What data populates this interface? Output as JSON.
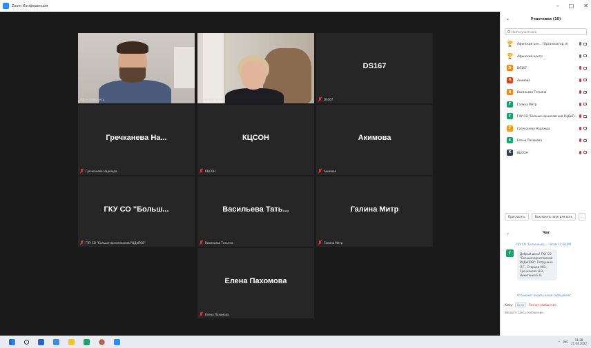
{
  "window": {
    "title": "Zoom Конференция",
    "controls": [
      "–",
      "□",
      "✕"
    ]
  },
  "tiles": [
    {
      "type": "video",
      "camera": "man",
      "caption": "Афинский центр",
      "muted": false,
      "active": true
    },
    {
      "type": "video",
      "camera": "woman",
      "caption": "Афинский центр",
      "muted": false,
      "active": false
    },
    {
      "type": "name",
      "display": "DS167",
      "caption": "DS167",
      "muted": true
    },
    {
      "type": "name",
      "display": "Гречканева  На...",
      "caption": "Гречканева Надежда",
      "muted": true
    },
    {
      "type": "name",
      "display": "КЦСОН",
      "caption": "КЦСОН",
      "muted": true
    },
    {
      "type": "name",
      "display": "Акимова",
      "caption": "Акимова",
      "muted": true
    },
    {
      "type": "name",
      "display": "ГКУ СО \"Больш...",
      "caption": "ГКУ СО \"Большечерниговский РЦДиПОВ\"",
      "muted": true
    },
    {
      "type": "name",
      "display": "Васильева  Тать...",
      "caption": "Васильева Татьяна",
      "muted": true
    },
    {
      "type": "name",
      "display": "Галина Митр",
      "caption": "Галина Митр",
      "muted": true
    },
    {
      "type": "name",
      "display": "Елена Пахомова",
      "caption": "Елена Пахомова",
      "muted": true
    }
  ],
  "participants_panel": {
    "title": "Участники (10)",
    "search_placeholder": "Найти участника",
    "participants": [
      {
        "name": "Афинский цен... (Организатор, я)",
        "avatar": "trophy",
        "color": "#f0b400",
        "muted": false
      },
      {
        "name": "Афинский центр",
        "avatar": "trophy",
        "color": "#f0b400",
        "muted": false
      },
      {
        "name": "DS167",
        "avatar": "D",
        "color": "#f08a1c",
        "muted": true
      },
      {
        "name": "Акимова",
        "avatar": "А",
        "color": "#d9481c",
        "muted": true
      },
      {
        "name": "Васильева Татьяна",
        "avatar": "В",
        "color": "#f08a1c",
        "muted": true
      },
      {
        "name": "Галина Митр",
        "avatar": "Г",
        "color": "#1aa36b",
        "muted": true
      },
      {
        "name": "ГКУ СО \"Большечерниговский РЦДиП...",
        "avatar": "Г",
        "color": "#1aa36b",
        "muted": true
      },
      {
        "name": "Гречканева Надежда",
        "avatar": "Г",
        "color": "#f0a020",
        "muted": true
      },
      {
        "name": "Елена Пахомова",
        "avatar": "Е",
        "color": "#1aa36b",
        "muted": true
      },
      {
        "name": "КЦСОН",
        "avatar": "К",
        "color": "#2a3a5a",
        "muted": true
      }
    ],
    "invite_label": "Пригласить",
    "mute_all_label": "Выключить звук для всех",
    "more_label": "..."
  },
  "chat": {
    "title": "Чат",
    "meta": "ГКУ СО \"Большечер...  - Всем  11:28 PM",
    "sender_initial": "Г",
    "sender_color": "#1aa36b",
    "message": "Добрый день! ГКУ СО\n\"Большечерниговский\nРЦДиПОВ\": Петрунина\nЛ.Г., Старцев М.В.,\nГречканева Н.В.,\nНикитенко Е.В.",
    "seen_label": "Кто может видеть ваши сообщения?",
    "to_label": "Кому:",
    "to_value": "Всем",
    "to_warning": "Личное сообщение",
    "input_placeholder": "Введите здесь сообщение..."
  },
  "taskbar": {
    "lang": "РУС",
    "time": "11:28",
    "date": "21.04.2022",
    "tray_arrow": "^"
  }
}
